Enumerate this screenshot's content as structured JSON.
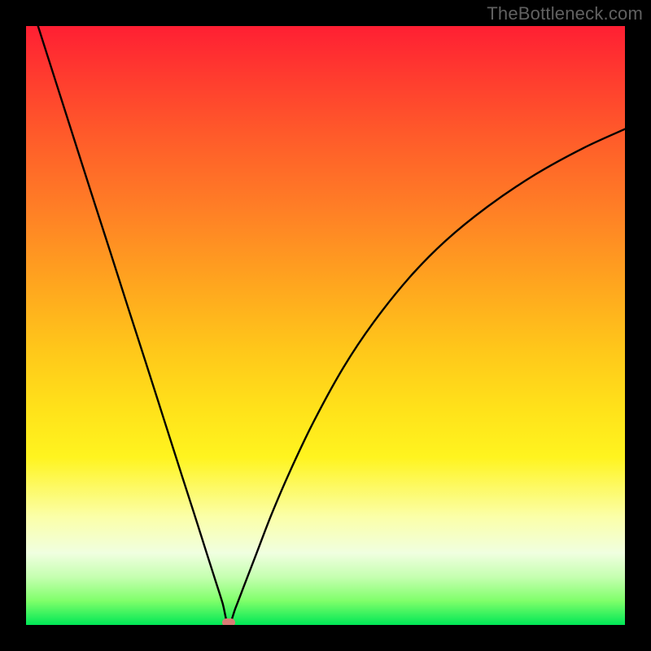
{
  "watermark": "TheBottleneck.com",
  "chart_data": {
    "type": "line",
    "title": "",
    "xlabel": "",
    "ylabel": "",
    "xlim": [
      0,
      100
    ],
    "ylim": [
      0,
      100
    ],
    "grid": false,
    "legend": false,
    "annotations": [],
    "notes": "Single black V-shaped bottleneck curve over a vertical green→red heat gradient. Axes unlabeled and plot area framed in black. Small salmon capsule marker at the curve minimum.",
    "minimum": {
      "x": 33.8,
      "y": 0.0
    },
    "marker_color": "#d87b75",
    "series": [
      {
        "name": "bottleneck-curve",
        "color": "#000000",
        "x": [
          2.0,
          5,
          8,
          11,
          14,
          17,
          20,
          23,
          26,
          28,
          30,
          31.5,
          32.8,
          33.8,
          35,
          36.5,
          38.5,
          41,
          44,
          48,
          53,
          58,
          64,
          70,
          77,
          85,
          93,
          100
        ],
        "y": [
          100,
          90.6,
          81.2,
          71.8,
          62.5,
          53.1,
          43.8,
          34.4,
          25.0,
          18.8,
          12.5,
          7.8,
          3.7,
          0.0,
          2.9,
          6.8,
          12.0,
          18.5,
          25.5,
          33.9,
          43.0,
          50.5,
          58.0,
          64.1,
          69.8,
          75.2,
          79.6,
          82.8
        ]
      }
    ],
    "gradient_stops": [
      {
        "pos": 0.0,
        "color": "#ff1f33"
      },
      {
        "pos": 0.3,
        "color": "#ff7d26"
      },
      {
        "pos": 0.64,
        "color": "#ffe21a"
      },
      {
        "pos": 0.88,
        "color": "#f0ffe0"
      },
      {
        "pos": 1.0,
        "color": "#00e756"
      }
    ]
  }
}
